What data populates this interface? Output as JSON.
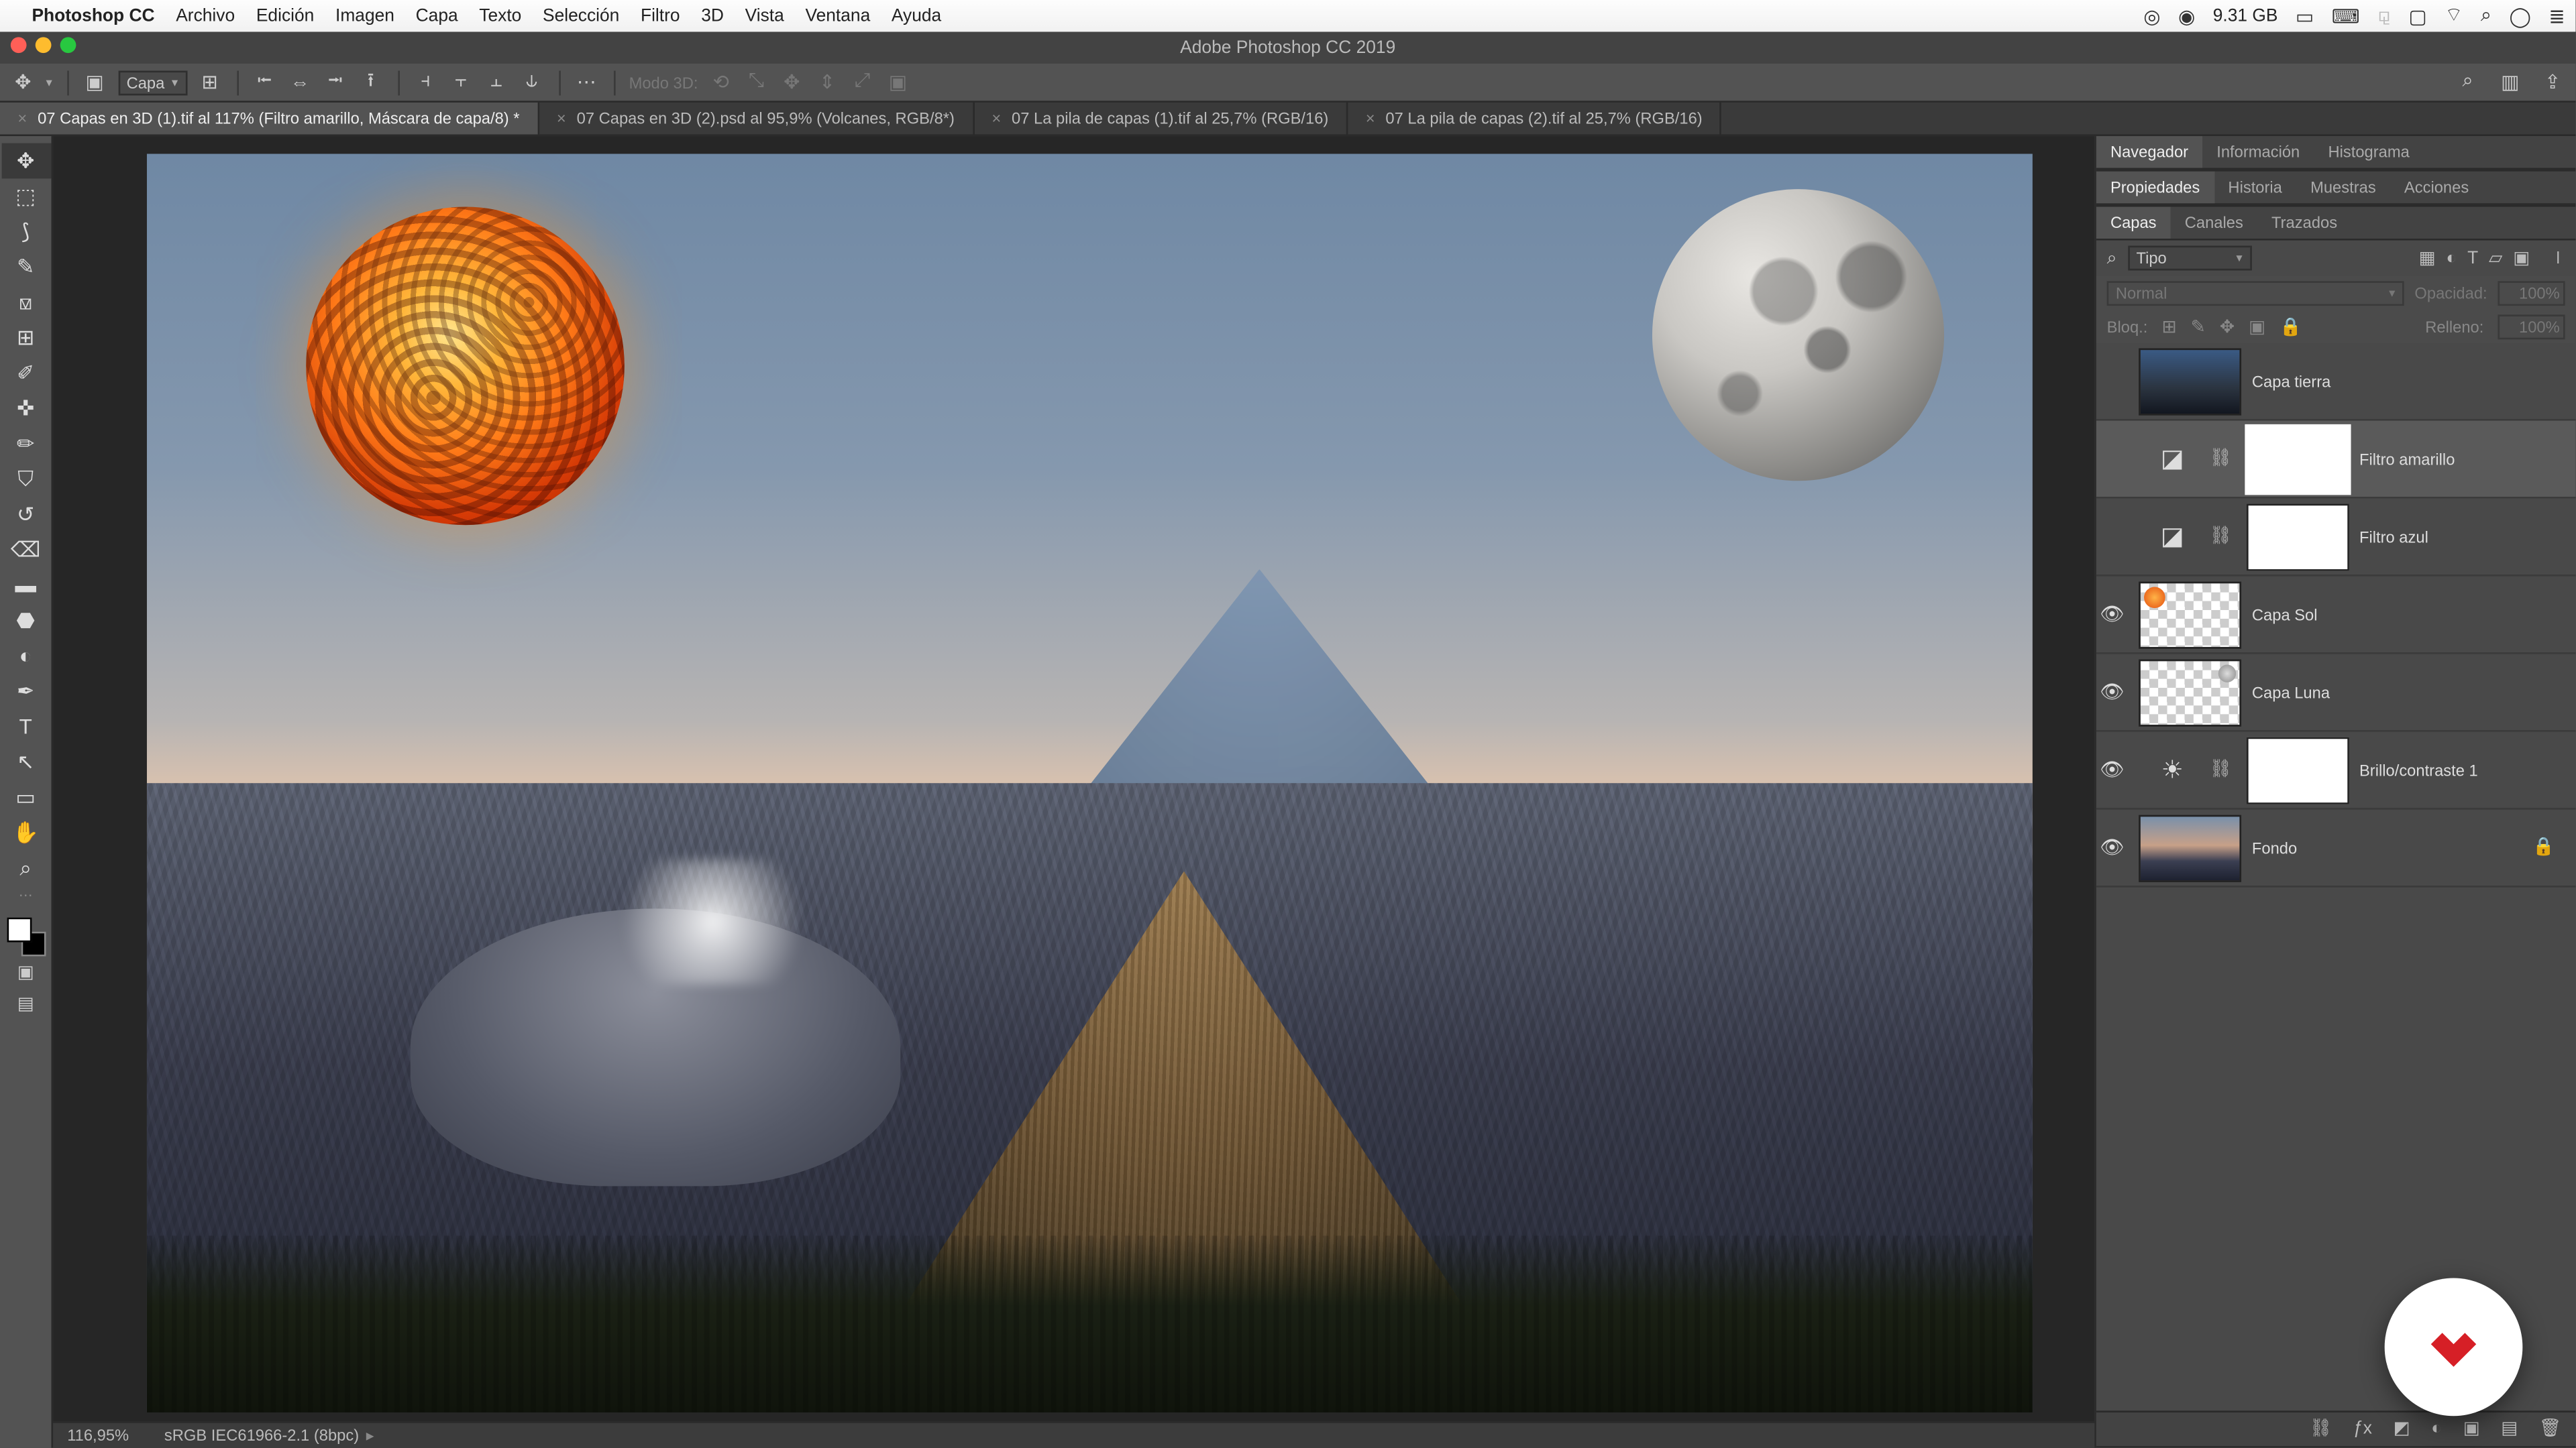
{
  "mac_menu": {
    "app_name": "Photoshop CC",
    "items": [
      "Archivo",
      "Edición",
      "Imagen",
      "Capa",
      "Texto",
      "Selección",
      "Filtro",
      "3D",
      "Vista",
      "Ventana",
      "Ayuda"
    ],
    "right_mem": "9.31 GB"
  },
  "window_title": "Adobe Photoshop CC 2019",
  "options_bar": {
    "auto_select_label": "Capa",
    "mode3d_label": "Modo 3D:"
  },
  "doc_tabs": [
    {
      "label": "07 Capas en 3D (1).tif al 117% (Filtro amarillo, Máscara de capa/8) *",
      "active": true
    },
    {
      "label": "07 Capas en 3D (2).psd al 95,9% (Volcanes, RGB/8*)",
      "active": false
    },
    {
      "label": "07 La pila de capas (1).tif al 25,7% (RGB/16)",
      "active": false
    },
    {
      "label": "07 La pila de capas (2).tif al 25,7% (RGB/16)",
      "active": false
    }
  ],
  "status": {
    "zoom": "116,95%",
    "profile": "sRGB IEC61966-2.1 (8bpc)"
  },
  "panels": {
    "group1": {
      "tabs": [
        "Navegador",
        "Información",
        "Histograma"
      ],
      "active": 0
    },
    "group2": {
      "tabs": [
        "Propiedades",
        "Historia",
        "Muestras",
        "Acciones"
      ],
      "active": 0
    },
    "group3": {
      "tabs": [
        "Capas",
        "Canales",
        "Trazados"
      ],
      "active": 0
    }
  },
  "layers_panel": {
    "kind_label": "Tipo",
    "blend_label": "Normal",
    "opacity_label": "Opacidad:",
    "opacity_value": "100%",
    "lock_label": "Bloq.:",
    "fill_label": "Relleno:",
    "fill_value": "100%"
  },
  "layers": [
    {
      "visible": false,
      "thumb": "earth",
      "mask": false,
      "adj": null,
      "name": "Capa tierra",
      "locked": false,
      "selected": false
    },
    {
      "visible": false,
      "thumb": null,
      "mask": true,
      "mask_selected": true,
      "adj": "photo-filter",
      "name": "Filtro amarillo",
      "locked": false,
      "selected": true
    },
    {
      "visible": false,
      "thumb": null,
      "mask": true,
      "adj": "photo-filter",
      "name": "Filtro azul",
      "locked": false,
      "selected": false
    },
    {
      "visible": true,
      "thumb": "sun-checker",
      "mask": false,
      "adj": null,
      "name": "Capa Sol",
      "locked": false,
      "selected": false
    },
    {
      "visible": true,
      "thumb": "moon-checker",
      "mask": false,
      "adj": null,
      "name": "Capa Luna",
      "locked": false,
      "selected": false
    },
    {
      "visible": true,
      "thumb": null,
      "mask": true,
      "adj": "brightness",
      "name": "Brillo/contraste 1",
      "locked": false,
      "selected": false
    },
    {
      "visible": true,
      "thumb": "fondo",
      "mask": false,
      "adj": null,
      "name": "Fondo",
      "locked": true,
      "selected": false
    }
  ]
}
